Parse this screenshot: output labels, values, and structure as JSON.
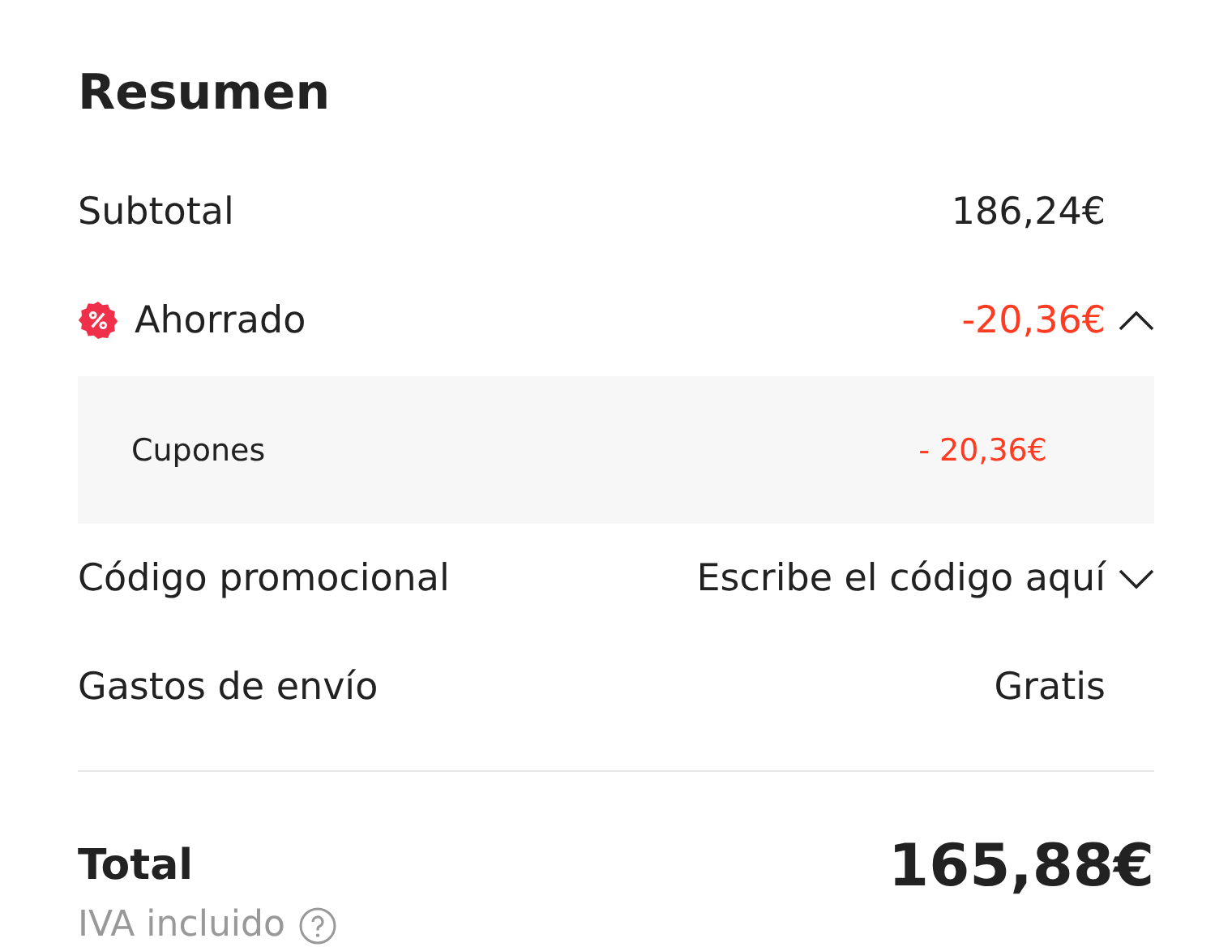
{
  "title": "Resumen",
  "subtotal": {
    "label": "Subtotal",
    "value": "186,24€"
  },
  "savings": {
    "label": "Ahorrado",
    "value": "-20,36€",
    "expanded": true,
    "items": [
      {
        "label": "Cupones",
        "value": "- 20,36€"
      }
    ]
  },
  "promo": {
    "label": "Código promocional",
    "placeholder": "Escribe el código aquí",
    "expanded": false
  },
  "shipping": {
    "label": "Gastos de envío",
    "value": "Gratis"
  },
  "total": {
    "label": "Total",
    "value": "165,88€",
    "note": "IVA incluido"
  }
}
